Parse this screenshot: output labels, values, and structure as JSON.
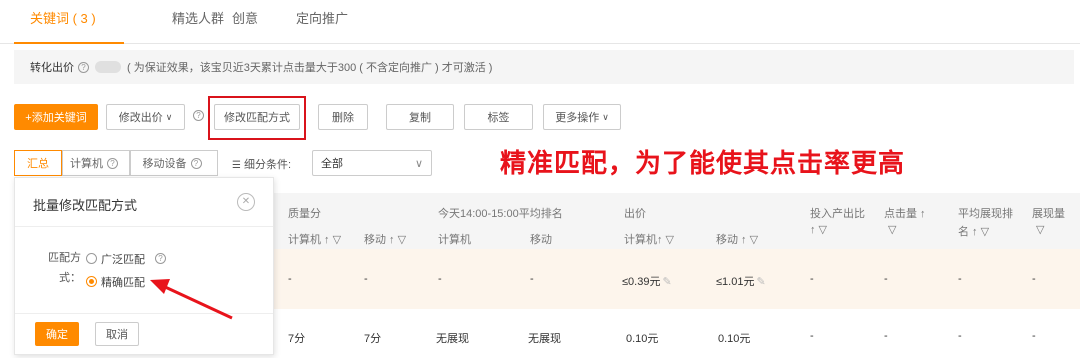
{
  "tabs": [
    {
      "label": "关键词 ( 3 )",
      "active": true
    },
    {
      "label": "精选人群"
    },
    {
      "label": "创意"
    },
    {
      "label": "定向推广"
    }
  ],
  "notice": {
    "label": "转化出价",
    "tip": "( 为保证效果，该宝贝近3天累计点击量大于300 ( 不含定向推广 ) 才可激活 )"
  },
  "toolbar": {
    "add_keyword": "+添加关键词",
    "modify_bid": "修改出价",
    "modify_match": "修改匹配方式",
    "delete": "删除",
    "copy": "复制",
    "tag": "标签",
    "more": "更多操作"
  },
  "annotation": "精准匹配，为了能使其点击率更高",
  "views": {
    "summary": "汇总",
    "computer": "计算机",
    "mobile": "移动设备",
    "filter_label": "细分条件:",
    "filter_value": "全部"
  },
  "table": {
    "headers": {
      "quality": "质量分",
      "quality_pc": "计算机 ↑ ▽",
      "quality_mobile": "移动 ↑ ▽",
      "rank": "今天14:00-15:00平均排名",
      "rank_pc": "计算机",
      "rank_mobile": "移动",
      "bid": "出价",
      "bid_pc": "计算机↑ ▽",
      "bid_mobile": "移动 ↑ ▽",
      "roi": "投入产出比",
      "roi_sort": "↑ ▽",
      "clicks": "点击量 ↑",
      "clicks_sort": "▽",
      "avg_rank": "平均展现排",
      "avg_rank2": "名 ↑ ▽",
      "impressions": "展现量",
      "impressions_sort": "▽"
    },
    "row1": {
      "quality_pc": "-",
      "quality_mobile": "-",
      "rank_pc": "-",
      "rank_mobile": "-",
      "bid_pc": "≤0.39元",
      "bid_mobile": "≤1.01元",
      "roi": "-",
      "clicks": "-",
      "avg_rank": "-",
      "impressions": "-"
    },
    "row2": {
      "quality_pc": "7分",
      "quality_mobile": "7分",
      "rank_pc": "无展现",
      "rank_mobile": "无展现",
      "bid_pc": "0.10元",
      "bid_mobile": "0.10元",
      "roi": "-",
      "clicks": "-",
      "avg_rank": "-",
      "impressions": "-"
    }
  },
  "popup": {
    "title": "批量修改匹配方式",
    "mode_label": "匹配方式：",
    "option_broad": "广泛匹配",
    "option_exact": "精确匹配",
    "selected": "精确匹配",
    "confirm": "确定",
    "cancel": "取消"
  },
  "colors": {
    "accent": "#ff8a00",
    "annotation": "#e8131b"
  }
}
